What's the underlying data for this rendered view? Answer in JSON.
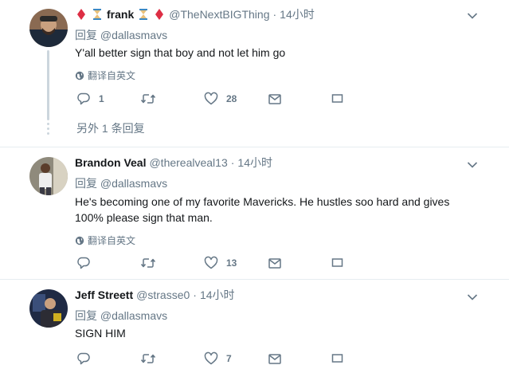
{
  "tweets": [
    {
      "name": "frank",
      "handle": "@TheNextBIGThing",
      "dot": "·",
      "time": "14小时",
      "reply_prefix": "回复",
      "reply_handle": "@dallasmavs",
      "text": "Y'all better sign that boy and not let him go",
      "translate": "翻译自英文",
      "reply_count": "1",
      "like_count": "28",
      "more_replies": "另外 1 条回复"
    },
    {
      "name": "Brandon Veal",
      "handle": "@therealveal13",
      "dot": "·",
      "time": "14小时",
      "reply_prefix": "回复",
      "reply_handle": "@dallasmavs",
      "text": "He's becoming one of my favorite Mavericks. He hustles soo hard and gives 100% please sign that man.",
      "translate": "翻译自英文",
      "like_count": "13"
    },
    {
      "name": "Jeff Streett",
      "handle": "@strasse0",
      "dot": "·",
      "time": "14小时",
      "reply_prefix": "回复",
      "reply_handle": "@dallasmavs",
      "text": "SIGN HIM",
      "like_count": "7"
    }
  ],
  "colors": {
    "text": "#14171a",
    "muted": "#657786",
    "divider": "#e6ecf0",
    "thread": "#ccd6dd",
    "emoji_red": "#dd2e44"
  },
  "icons": [
    "reply-icon",
    "retweet-icon",
    "like-icon",
    "message-icon",
    "share-icon",
    "globe-icon",
    "chevron-down-icon"
  ]
}
